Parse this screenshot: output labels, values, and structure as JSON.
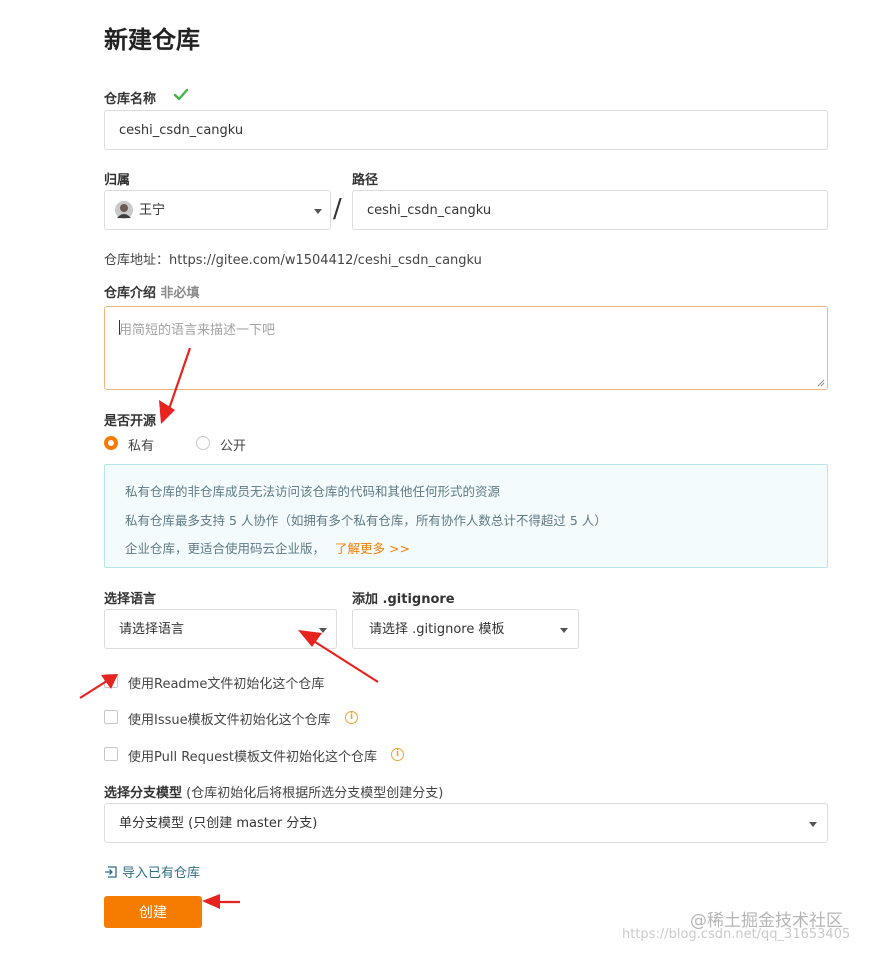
{
  "page_title": "新建仓库",
  "repo_name": {
    "label": "仓库名称",
    "value": "ceshi_csdn_cangku"
  },
  "owner": {
    "label": "归属",
    "value": "王宁"
  },
  "path": {
    "label": "路径",
    "value": "ceshi_csdn_cangku",
    "separator": "/"
  },
  "repo_url": {
    "label": "仓库地址：",
    "value": "https://gitee.com/w1504412/ceshi_csdn_cangku"
  },
  "description": {
    "label": "仓库介绍",
    "optional": "非必填",
    "placeholder": "用简短的语言来描述一下吧"
  },
  "visibility": {
    "label": "是否开源",
    "options": [
      "私有",
      "公开"
    ],
    "selected": "私有"
  },
  "notice": {
    "lines": [
      "私有仓库的非仓库成员无法访问该仓库的代码和其他任何形式的资源",
      "私有仓库最多支持 5 人协作（如拥有多个私有仓库，所有协作人数总计不得超过 5 人）",
      "企业仓库，更适合使用码云企业版，"
    ],
    "link": "了解更多 >>"
  },
  "language": {
    "label": "选择语言",
    "placeholder": "请选择语言"
  },
  "gitignore": {
    "label": "添加 .gitignore",
    "placeholder": "请选择 .gitignore 模板"
  },
  "checkboxes": [
    {
      "label": "使用Readme文件初始化这个仓库",
      "checked": false
    },
    {
      "label": "使用Issue模板文件初始化这个仓库",
      "checked": false
    },
    {
      "label": "使用Pull Request模板文件初始化这个仓库",
      "checked": false
    }
  ],
  "branch_model": {
    "label": "选择分支模型",
    "hint": "(仓库初始化后将根据所选分支模型创建分支)",
    "value": "单分支模型 (只创建 master 分支)"
  },
  "import_link": "导入已有仓库",
  "create_button": "创建",
  "watermark": {
    "brand": "@稀土掘金技术社区",
    "url": "https://blog.csdn.net/qq_31653405"
  },
  "colors": {
    "accent": "#f57c00",
    "check": "#44b549",
    "annotation": "#e8231f"
  }
}
